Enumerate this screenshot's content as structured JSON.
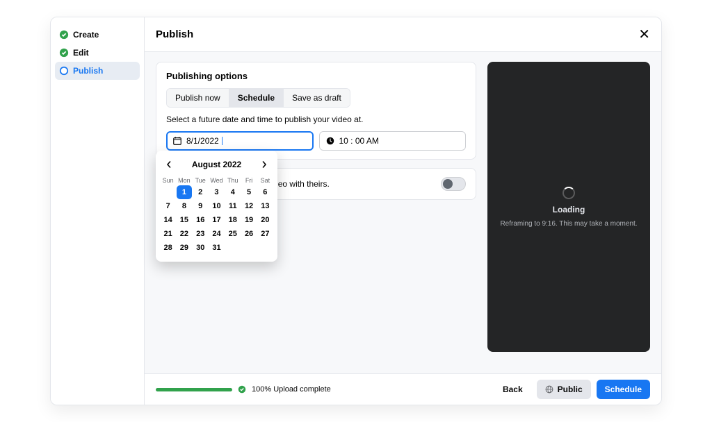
{
  "header": {
    "title": "Publish"
  },
  "steps": [
    {
      "label": "Create",
      "state": "done"
    },
    {
      "label": "Edit",
      "state": "done"
    },
    {
      "label": "Publish",
      "state": "current"
    }
  ],
  "publishing": {
    "heading": "Publishing options",
    "tabs": [
      {
        "label": "Publish now",
        "active": false
      },
      {
        "label": "Schedule",
        "active": true
      },
      {
        "label": "Save as draft",
        "active": false
      }
    ],
    "hint": "Select a future date and time to publish your video at.",
    "date_value": "8/1/2022",
    "time_value": "10 : 00 AM"
  },
  "calendar": {
    "title": "August 2022",
    "dows": [
      "Sun",
      "Mon",
      "Tue",
      "Wed",
      "Thu",
      "Fri",
      "Sat"
    ],
    "selected_day": 1,
    "last_day": 31
  },
  "remix": {
    "text_suffix": "reate a reel that plays your video with theirs.",
    "on": false
  },
  "preview": {
    "loading": "Loading",
    "subtitle": "Reframing to 9:16. This may take a moment."
  },
  "footer": {
    "progress_text": "100% Upload complete",
    "back": "Back",
    "audience": "Public",
    "primary": "Schedule"
  }
}
